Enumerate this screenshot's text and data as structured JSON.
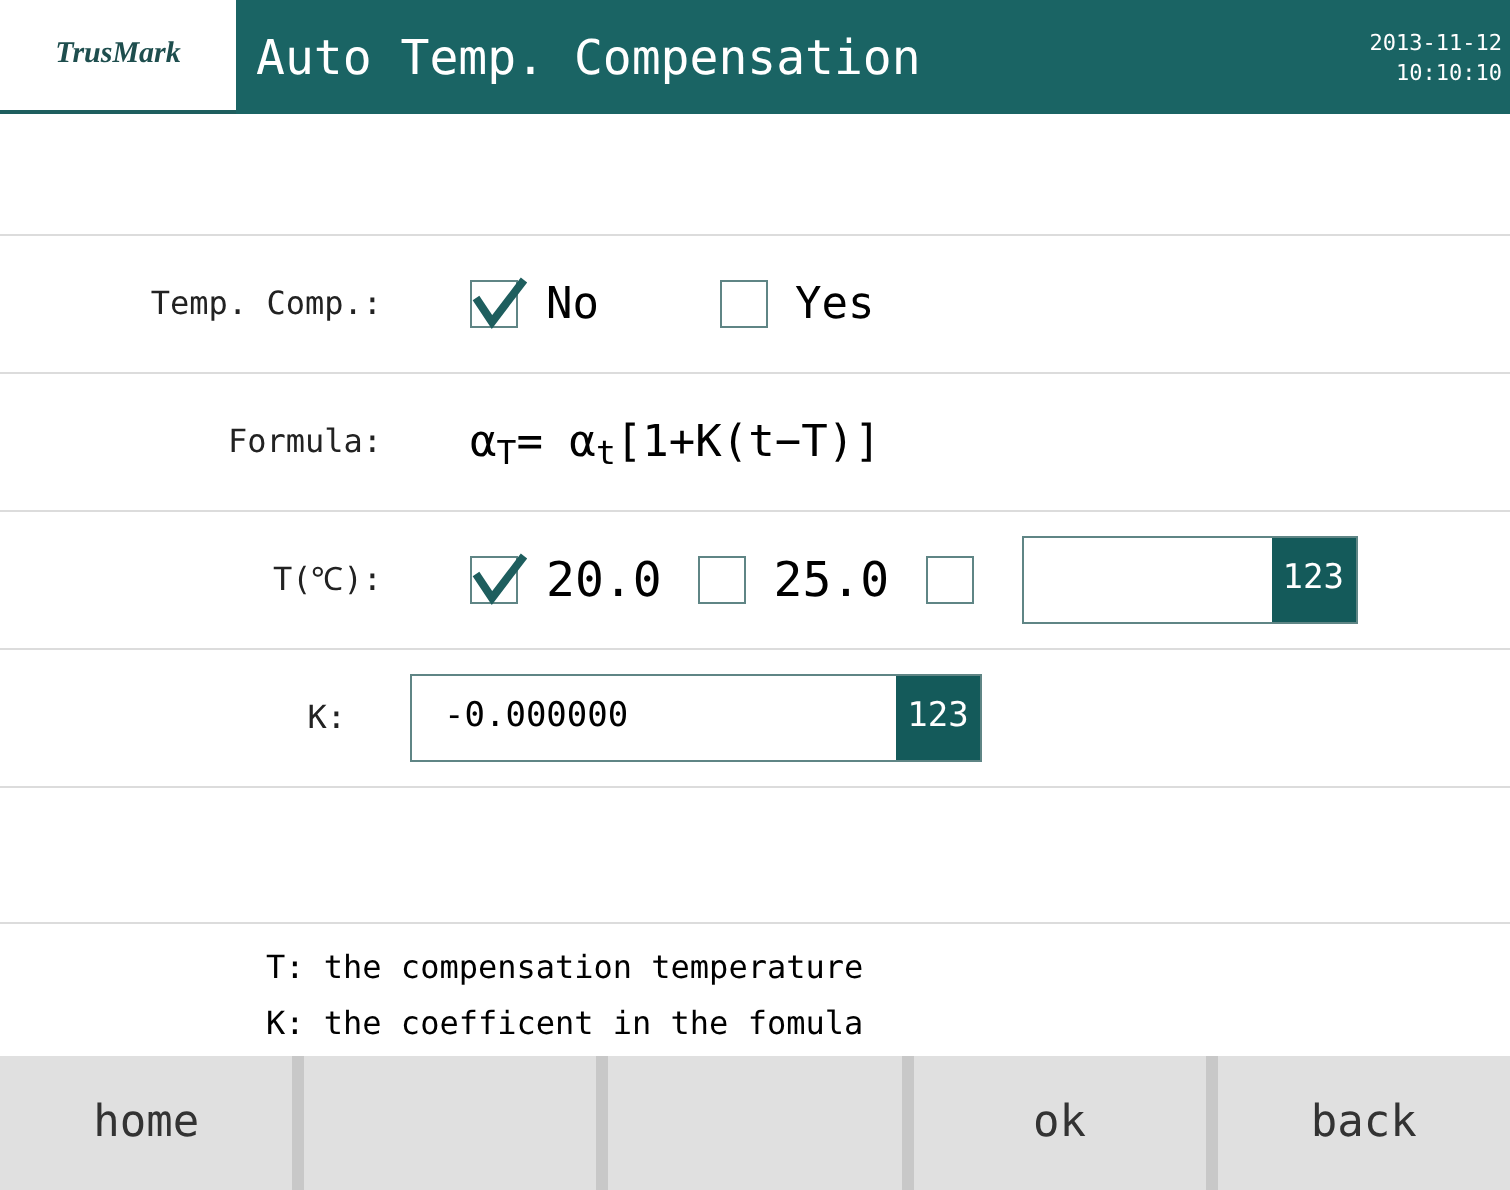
{
  "header": {
    "logo": "TrusMark",
    "title": "Auto Temp. Compensation",
    "date": "2013-11-12",
    "time": "10:10:10"
  },
  "temp_comp": {
    "label": "Temp. Comp.:",
    "options": [
      {
        "label": "No",
        "checked": true
      },
      {
        "label": "Yes",
        "checked": false
      }
    ]
  },
  "formula": {
    "label": "Formula:",
    "text": "α$_{T}$= α$_{t}$[1+K(t−T)]"
  },
  "temperature": {
    "label": "T(℃):",
    "options": [
      {
        "kind": "option",
        "label": "20.0",
        "checked": true
      },
      {
        "kind": "option",
        "label": "25.0",
        "checked": false
      },
      {
        "kind": "custom",
        "checked": false,
        "keypad": "123"
      }
    ]
  },
  "k": {
    "label": "K:",
    "value": "-0.000000",
    "keypad": "123"
  },
  "notes": [
    "T: the compensation temperature",
    "K: the coefficent in the fomula"
  ],
  "buttons": [
    {
      "kind": "text",
      "label": "home"
    },
    {
      "kind": "blank"
    },
    {
      "kind": "blank"
    },
    {
      "kind": "text",
      "label": "ok"
    },
    {
      "kind": "text",
      "label": "back"
    }
  ]
}
